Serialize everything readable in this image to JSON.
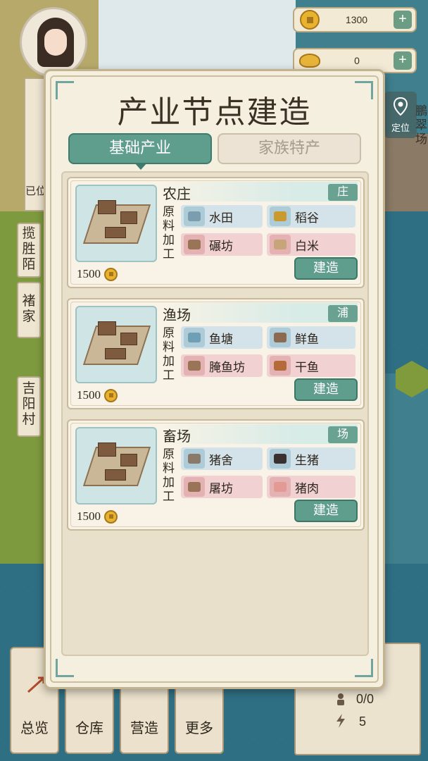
{
  "resources": {
    "copper": {
      "value": "1300",
      "icon": "copper-coin-icon"
    },
    "gold": {
      "value": "0",
      "icon": "gold-ingot-icon"
    }
  },
  "side": {
    "partial_text": "已位",
    "btn1": "揽胜陌",
    "btn2": "褚家",
    "btn3": "吉阳村"
  },
  "locate": {
    "label": "定位",
    "vertical": "鵬翠场"
  },
  "bottom_nav": {
    "overview": "总览",
    "warehouse": "仓库",
    "build": "营造",
    "more": "更多"
  },
  "bottom_stats": {
    "ratio": "0/0",
    "energy": "5"
  },
  "modal": {
    "title": "产业节点建造",
    "tabs": [
      {
        "label": "基础产业",
        "active": true
      },
      {
        "label": "家族特产",
        "active": false
      }
    ],
    "raw_label": "原料",
    "process_label": "加工",
    "build_label": "建造",
    "cards": [
      {
        "name": "农庄",
        "tag": "庄",
        "raw": [
          {
            "label": "水田",
            "icon": "paddy-field-icon"
          },
          {
            "label": "稻谷",
            "icon": "rice-grain-icon"
          }
        ],
        "process": [
          {
            "label": "碾坊",
            "icon": "mill-icon"
          },
          {
            "label": "白米",
            "icon": "rice-sack-icon"
          }
        ],
        "cost": "1500"
      },
      {
        "name": "渔场",
        "tag": "浦",
        "raw": [
          {
            "label": "鱼塘",
            "icon": "fish-pond-icon"
          },
          {
            "label": "鲜鱼",
            "icon": "fresh-fish-icon"
          }
        ],
        "process": [
          {
            "label": "腌鱼坊",
            "icon": "salting-workshop-icon"
          },
          {
            "label": "干鱼",
            "icon": "dried-fish-icon"
          }
        ],
        "cost": "1500"
      },
      {
        "name": "畜场",
        "tag": "场",
        "raw": [
          {
            "label": "猪舍",
            "icon": "pigsty-icon"
          },
          {
            "label": "生猪",
            "icon": "pig-icon"
          }
        ],
        "process": [
          {
            "label": "屠坊",
            "icon": "butchery-icon"
          },
          {
            "label": "猪肉",
            "icon": "pork-icon"
          }
        ],
        "cost": "1500"
      }
    ]
  },
  "colors": {
    "accent_teal": "#5f9d8d",
    "raw_bg": "#d4e3ea",
    "process_bg": "#f1d1d1",
    "panel_bg": "#f5efdf"
  }
}
